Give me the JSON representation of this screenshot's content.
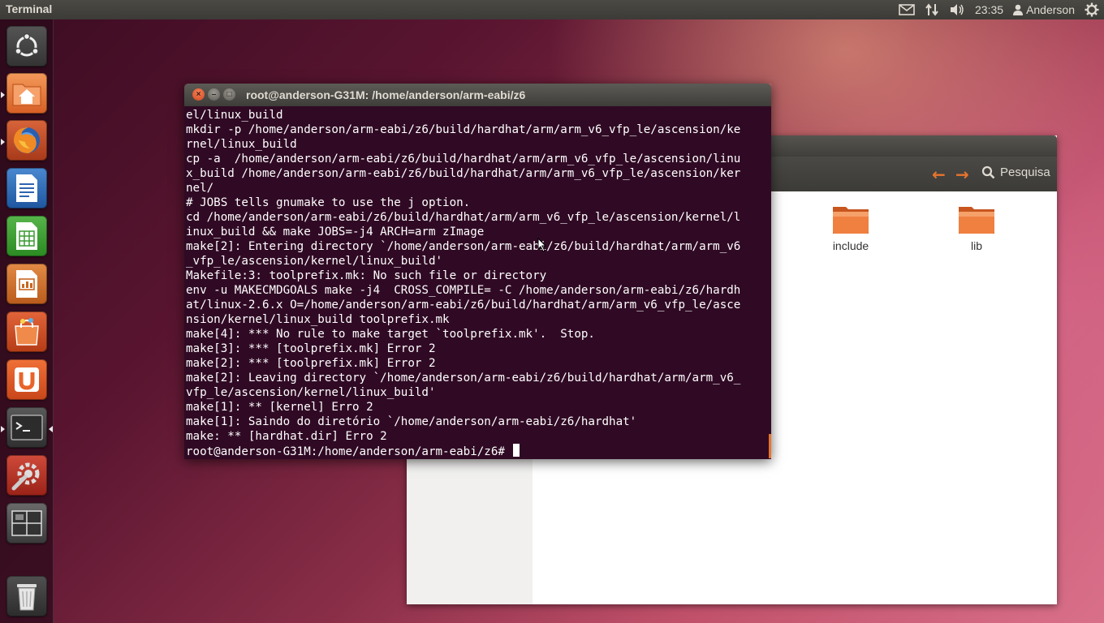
{
  "panel": {
    "app_title": "Terminal",
    "clock": "23:35",
    "user": "Anderson",
    "icons": [
      "mail-icon",
      "network-icon",
      "volume-icon",
      "user-icon",
      "power-gear-icon"
    ]
  },
  "launcher": {
    "items": [
      "dash-home",
      "home-folder",
      "firefox",
      "libreoffice-writer",
      "libreoffice-calc",
      "libreoffice-impress",
      "ubuntu-software-center",
      "ubuntu-one",
      "terminal",
      "system-settings",
      "workspace-switcher",
      "trash"
    ]
  },
  "file_manager": {
    "search_label": "Pesquisa",
    "folders": [
      {
        "name": "include"
      },
      {
        "name": "lib"
      }
    ]
  },
  "terminal": {
    "title": "root@anderson-G31M: /home/anderson/arm-eabi/z6",
    "lines": [
      "el/linux_build",
      "mkdir -p /home/anderson/arm-eabi/z6/build/hardhat/arm/arm_v6_vfp_le/ascension/ke",
      "rnel/linux_build",
      "cp -a  /home/anderson/arm-eabi/z6/build/hardhat/arm/arm_v6_vfp_le/ascension/linu",
      "x_build /home/anderson/arm-eabi/z6/build/hardhat/arm/arm_v6_vfp_le/ascension/ker",
      "nel/",
      "# JOBS tells gnumake to use the j option.",
      "cd /home/anderson/arm-eabi/z6/build/hardhat/arm/arm_v6_vfp_le/ascension/kernel/l",
      "inux_build && make JOBS=-j4 ARCH=arm zImage",
      "make[2]: Entering directory `/home/anderson/arm-eabi/z6/build/hardhat/arm/arm_v6",
      "_vfp_le/ascension/kernel/linux_build'",
      "Makefile:3: toolprefix.mk: No such file or directory",
      "env -u MAKECMDGOALS make -j4  CROSS_COMPILE= -C /home/anderson/arm-eabi/z6/hardh",
      "at/linux-2.6.x O=/home/anderson/arm-eabi/z6/build/hardhat/arm/arm_v6_vfp_le/asce",
      "nsion/kernel/linux_build toolprefix.mk",
      "make[4]: *** No rule to make target `toolprefix.mk'.  Stop.",
      "make[3]: *** [toolprefix.mk] Error 2",
      "make[2]: *** [toolprefix.mk] Error 2",
      "make[2]: Leaving directory `/home/anderson/arm-eabi/z6/build/hardhat/arm/arm_v6_",
      "vfp_le/ascension/kernel/linux_build'",
      "make[1]: ** [kernel] Erro 2",
      "make[1]: Saindo do diretório `/home/anderson/arm-eabi/z6/hardhat'",
      "make: ** [hardhat.dir] Erro 2"
    ],
    "prompt": "root@anderson-G31M:/home/anderson/arm-eabi/z6# "
  },
  "colors": {
    "terminal_bg": "#300a24",
    "accent_orange": "#e8742e",
    "panel_bg": "#3c3b37"
  }
}
